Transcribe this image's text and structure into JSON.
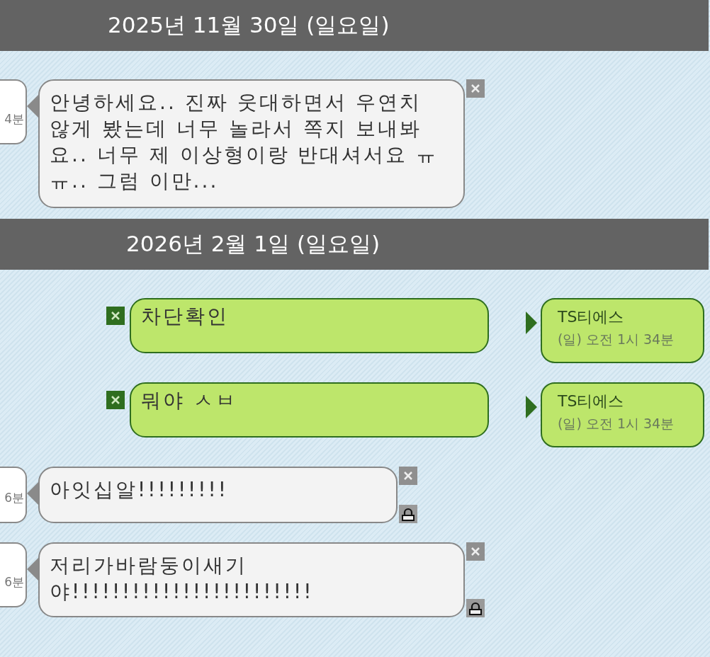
{
  "sections": [
    {
      "date": "2025년 11월 30일 (일요일)",
      "messages": [
        {
          "kind": "incoming",
          "time": "4분",
          "text": "안녕하세요.. 진짜 웃대하면서 우연치 않게 봤는데 너무 놀라서 쪽지 보내봐요.. 너무 제 이상형이랑 반대셔서요 ㅠㅠ.. 그럼 이만...",
          "locked": false
        }
      ]
    },
    {
      "date": "2026년 2월 1일 (일요일)",
      "messages": [
        {
          "kind": "outgoing",
          "text": "차단확인",
          "sender": "TS티에스",
          "time": "(일) 오전 1시 34분"
        },
        {
          "kind": "outgoing",
          "text": "뭐야 ㅅㅂ",
          "sender": "TS티에스",
          "time": "(일) 오전 1시 34분"
        },
        {
          "kind": "incoming",
          "time": "6분",
          "text": "아잇십알!!!!!!!!!",
          "locked": true
        },
        {
          "kind": "incoming",
          "time": "6분",
          "text": "저리가바람둥이새기야!!!!!!!!!!!!!!!!!!!!!!!!",
          "locked": true
        }
      ]
    }
  ]
}
